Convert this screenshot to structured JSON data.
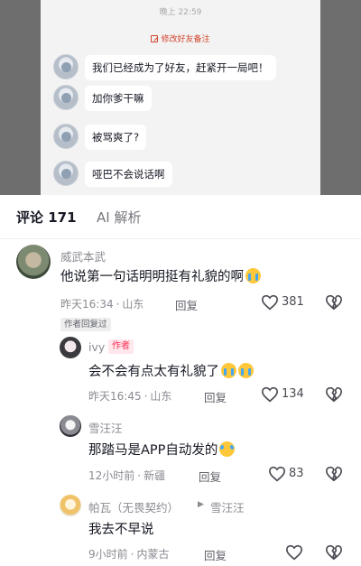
{
  "chat": {
    "time": "晚上 22:59",
    "note_action": "修改好友备注",
    "messages": [
      "我们已经成为了好友，赶紧开一局吧！",
      "加你爹干嘛",
      "被骂爽了?",
      "哑巴不会说话啊"
    ]
  },
  "tabs": {
    "comments_label": "评论 171",
    "ai_label": "AI 解析"
  },
  "comments": [
    {
      "username": "威武本武",
      "text": "他说第一句话明明挺有礼貌的啊",
      "emoji": "loudly-crying-face",
      "time": "昨天16:34",
      "location": "山东",
      "reply_label": "回复",
      "likes": "381",
      "author_replied_badge": "作者回复过"
    },
    {
      "username": "ivy",
      "author_badge": "作者",
      "text": "会不会有点太有礼貌了",
      "emoji": "loudly-crying-face",
      "time": "昨天16:45",
      "location": "山东",
      "reply_label": "回复",
      "likes": "134"
    },
    {
      "username": "雪汪汪",
      "text": "那踏马是APP自动发的",
      "emoji": "rolling-laughing-face",
      "time": "12小时前",
      "location": "新疆",
      "reply_label": "回复",
      "likes": "83"
    },
    {
      "username": "帕瓦（无畏契约）",
      "reply_to": "雪汪汪",
      "text": "我去不早说",
      "time": "9小时前",
      "location": "内蒙古",
      "reply_label": "回复",
      "likes": ""
    }
  ],
  "colors": {
    "author_badge": "#fe2c55",
    "text_primary": "#161823",
    "text_secondary": "#8a8b91"
  }
}
